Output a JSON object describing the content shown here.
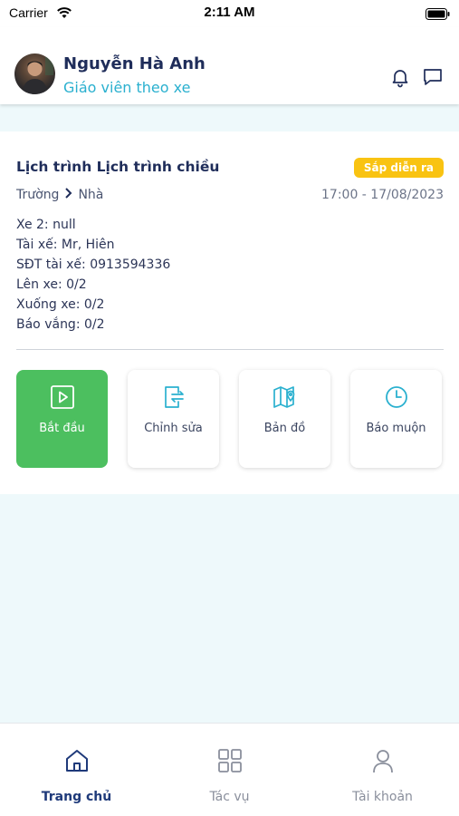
{
  "status_bar": {
    "carrier": "Carrier",
    "time": "2:11 AM"
  },
  "header": {
    "user_name": "Nguyễn Hà Anh",
    "user_role": "Giáo viên theo xe",
    "icons": [
      "bell-icon",
      "chat-icon"
    ]
  },
  "schedule": {
    "title": "Lịch trình Lịch trình chiều",
    "status": "Sắp diễn ra",
    "route_from": "Trường",
    "route_to": "Nhà",
    "datetime": "17:00 - 17/08/2023",
    "info": [
      "Xe 2: null",
      "Tài xế: Mr,  Hiên",
      "SĐT tài xế: 0913594336",
      "Lên xe: 0/2",
      "Xuống xe: 0/2",
      "Báo vắng: 0/2"
    ]
  },
  "actions": [
    {
      "label": "Bắt đầu",
      "icon": "play-icon"
    },
    {
      "label": "Chỉnh sửa",
      "icon": "edit-transfer-icon"
    },
    {
      "label": "Bản đồ",
      "icon": "map-icon"
    },
    {
      "label": "Báo muộn",
      "icon": "clock-icon"
    }
  ],
  "tabs": [
    {
      "label": "Trang chủ",
      "icon": "home-icon",
      "active": true
    },
    {
      "label": "Tác vụ",
      "icon": "grid-icon",
      "active": false
    },
    {
      "label": "Tài khoản",
      "icon": "user-icon",
      "active": false
    }
  ],
  "colors": {
    "primary_text": "#1f2d5a",
    "accent_cyan": "#2ab0cf",
    "badge_yellow": "#f9c312",
    "start_green": "#4cbf5f",
    "background": "#eef9fb"
  }
}
